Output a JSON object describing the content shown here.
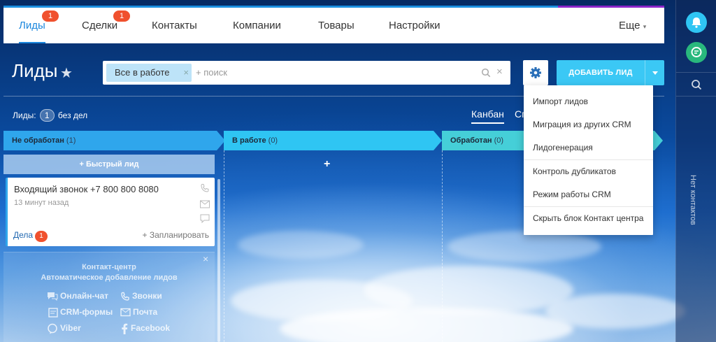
{
  "nav": {
    "tabs": [
      {
        "label": "Лиды",
        "badge": "1"
      },
      {
        "label": "Сделки",
        "badge": "1"
      },
      {
        "label": "Контакты"
      },
      {
        "label": "Компании"
      },
      {
        "label": "Товары"
      },
      {
        "label": "Настройки"
      }
    ],
    "more": "Еще",
    "active_tab": "Лиды"
  },
  "page": {
    "title": "Лиды"
  },
  "search": {
    "filter_chip": "Все в работе",
    "placeholder": "+ поиск"
  },
  "toolbar": {
    "add_label": "ДОБАВИТЬ ЛИД"
  },
  "summary": {
    "label": "Лиды:",
    "count": "1",
    "suffix": "без дел"
  },
  "views": {
    "kanban": "Канбан",
    "list_partial": "Сп"
  },
  "columns": [
    {
      "title": "Не обработан",
      "count": "(1)",
      "color": "#2fa6ec"
    },
    {
      "title": "В работе",
      "count": "(0)",
      "color": "#2fc5f3"
    },
    {
      "title": "Обработан",
      "count": "(0)",
      "color": "#45cfd8"
    }
  ],
  "quick_lead": "+  Быстрый лид",
  "lead_card": {
    "title": "Входящий звонок +7 800 800 8080",
    "time": "13 минут назад",
    "deals_label": "Дела",
    "deals_count": "1",
    "plan": "+ Запланировать"
  },
  "contact_center": {
    "title_line1": "Контакт-центр",
    "title_line2": "Автоматическое добавление лидов",
    "items": [
      {
        "label": "Онлайн-чат",
        "icon": "chat-icon"
      },
      {
        "label": "Звонки",
        "icon": "phone-icon"
      },
      {
        "label": "CRM-формы",
        "icon": "form-icon"
      },
      {
        "label": "Почта",
        "icon": "mail-icon"
      },
      {
        "label": "Viber",
        "icon": "viber-icon"
      },
      {
        "label": "Facebook",
        "icon": "facebook-icon"
      }
    ]
  },
  "menu": {
    "items": [
      "Импорт лидов",
      "Миграция из других CRM",
      "Лидогенерация",
      "Контроль дубликатов",
      "Режим работы CRM",
      "Скрыть блок Контакт центра"
    ]
  },
  "rightbar": {
    "no_contacts": "Нет контактов"
  },
  "colors": {
    "accent": "#1b87dd",
    "add_button": "#3bc8f5",
    "badge": "#f0512e"
  }
}
